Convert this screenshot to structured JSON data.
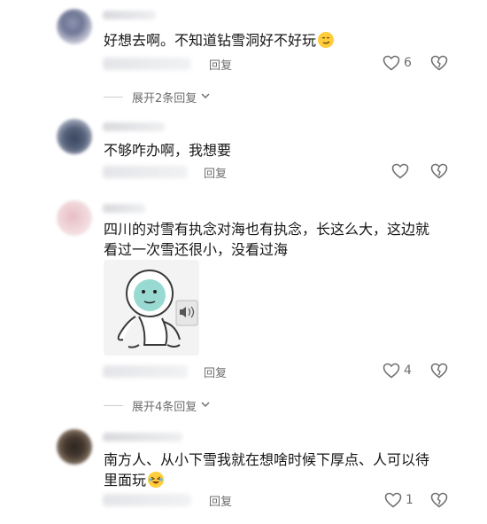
{
  "comments": [
    {
      "text": "好想去啊。不知道钻雪洞好不好玩",
      "reply_label": "回复",
      "likes": "6",
      "expand_label": "展开2条回复"
    },
    {
      "text": "不够咋办啊，我想要",
      "reply_label": "回复"
    },
    {
      "text_line1": "四川的对雪有执念对海也有执念，长这么大，这边就",
      "text_line2": "看过一次雪还很小，没看过海",
      "reply_label": "回复",
      "likes": "4",
      "expand_label": "展开4条回复"
    },
    {
      "text_line1": "南方人、从小下雪我就在想啥时候下厚点、人可以待",
      "text_line2": "里面玩",
      "reply_label": "回复",
      "likes": "1"
    }
  ],
  "icons": {
    "like": "heart-outline-icon",
    "dislike": "broken-heart-icon",
    "expand": "chevron-down-icon",
    "audio": "speaker-icon"
  },
  "colors": {
    "text": "#161616",
    "secondary": "#6e6e6e",
    "emoji_yellow": "#ffcd3c"
  }
}
